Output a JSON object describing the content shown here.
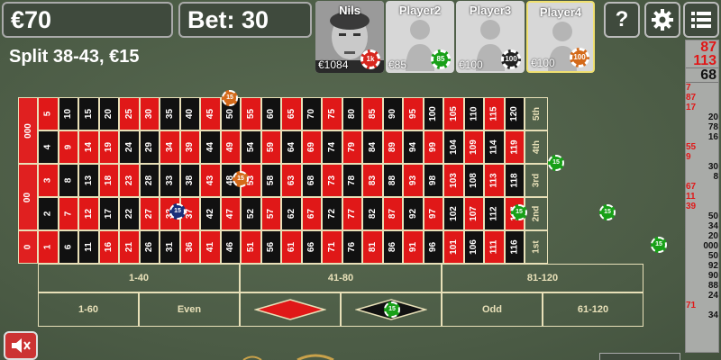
{
  "header": {
    "balance": "€70",
    "bet": "Bet: 30",
    "help_label": "?",
    "settings_icon": "gear-icon",
    "menu_icon": "menu-icon"
  },
  "players": [
    {
      "name": "Nils",
      "money": "€1084",
      "chip": "1k",
      "chip_color": "#d7261e",
      "photo": true
    },
    {
      "name": "Player2",
      "money": "€85",
      "chip": "85",
      "chip_color": "#18a018",
      "photo": false
    },
    {
      "name": "Player3",
      "money": "€100",
      "chip": "100",
      "chip_color": "#222222",
      "photo": false
    },
    {
      "name": "Player4",
      "money": "€100",
      "chip": "100",
      "chip_color": "#d46a1a",
      "photo": false,
      "active": true
    }
  ],
  "last_bet": "Split 38-43, €15",
  "history": {
    "big": [
      {
        "value": "87",
        "color": "red"
      },
      {
        "value": "113",
        "color": "red"
      },
      {
        "value": "68",
        "color": "black"
      }
    ],
    "rows": [
      {
        "left": "7",
        "right": ""
      },
      {
        "left": "87",
        "right": ""
      },
      {
        "left": "17",
        "right": ""
      },
      {
        "left": "",
        "right": "20"
      },
      {
        "left": "",
        "right": "78"
      },
      {
        "left": "",
        "right": "16"
      },
      {
        "left": "55",
        "right": ""
      },
      {
        "left": "9",
        "right": ""
      },
      {
        "left": "",
        "right": "30"
      },
      {
        "left": "",
        "right": "8"
      },
      {
        "left": "67",
        "right": ""
      },
      {
        "left": "11",
        "right": ""
      },
      {
        "left": "39",
        "right": ""
      },
      {
        "left": "",
        "right": "50"
      },
      {
        "left": "",
        "right": "34"
      },
      {
        "left": "",
        "right": "20"
      },
      {
        "left": "",
        "right": "000"
      },
      {
        "left": "",
        "right": "50"
      },
      {
        "left": "",
        "right": "92"
      },
      {
        "left": "",
        "right": "90"
      },
      {
        "left": "",
        "right": "88"
      },
      {
        "left": "",
        "right": "24"
      },
      {
        "left": "71",
        "right": ""
      },
      {
        "left": "",
        "right": "34"
      }
    ]
  },
  "board": {
    "zeros": [
      "000",
      "00",
      "0"
    ],
    "column_labels": [
      "5th",
      "4th",
      "3rd",
      "2nd",
      "1st"
    ],
    "outside_row1": [
      "1-40",
      "41-80",
      "81-120"
    ],
    "outside_row2": [
      "1-60",
      "Even",
      "",
      "",
      "Odd",
      "61-120"
    ],
    "chips": [
      {
        "label": "15",
        "color": "orange"
      },
      {
        "label": "15",
        "color": "orange"
      },
      {
        "label": "15",
        "color": "navy"
      },
      {
        "label": "15",
        "color": "green"
      },
      {
        "label": "15",
        "color": "green"
      },
      {
        "label": "15",
        "color": "green"
      },
      {
        "label": "15",
        "color": "green"
      },
      {
        "label": "15",
        "color": "green"
      }
    ]
  },
  "colors": {
    "red": "#e01818",
    "black": "#111111",
    "felt": "#4d5d47",
    "line": "#e8e0b8"
  }
}
